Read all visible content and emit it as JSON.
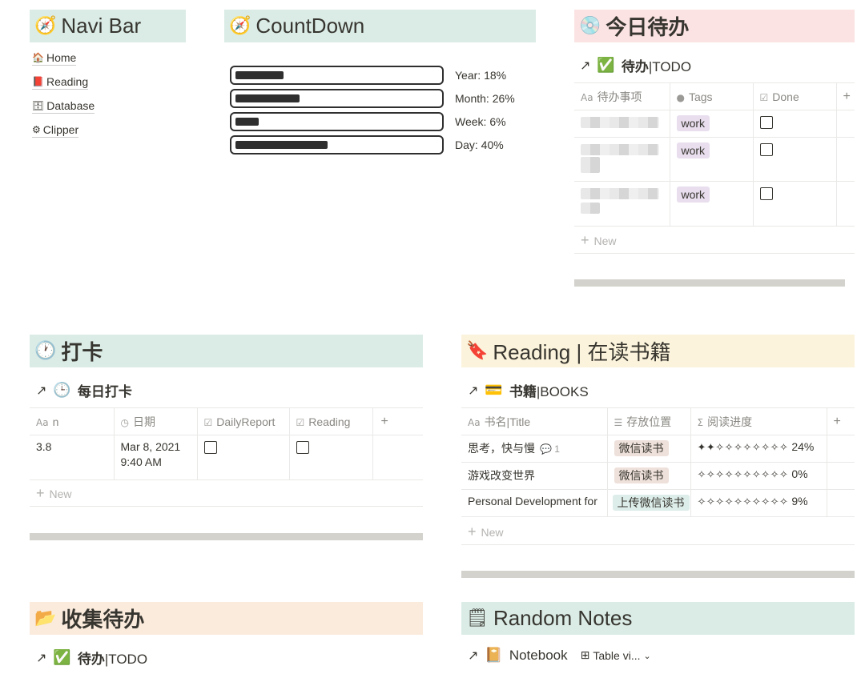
{
  "navi_bar": {
    "icon": "compass-icon",
    "title": "Navi Bar",
    "bg": "#dbece7",
    "links": [
      {
        "icon": "house-icon",
        "label": "Home"
      },
      {
        "icon": "book-icon",
        "label": "Reading"
      },
      {
        "icon": "cabinet-icon",
        "label": "Database"
      },
      {
        "icon": "gear-icon",
        "label": "Clipper"
      }
    ]
  },
  "countdown": {
    "icon": "compass-icon",
    "title": "CountDown",
    "bg": "#dbece7",
    "bars": [
      {
        "label": "Year: 18%",
        "percent": 18
      },
      {
        "label": "Month: 26%",
        "percent": 26
      },
      {
        "label": "Week: 6%",
        "percent": 6
      },
      {
        "label": "Day: 40%",
        "percent": 40
      }
    ]
  },
  "today_todo": {
    "icon": "disc-icon",
    "title": "今日待办",
    "bg": "#fbe3e3",
    "db_title_bold": "待办",
    "db_title_rest": "|TODO",
    "columns": [
      "待办事项",
      "Tags",
      "Done"
    ],
    "rows": [
      {
        "tag": "work",
        "done": false
      },
      {
        "tag": "work",
        "done": false
      },
      {
        "tag": "work",
        "done": false
      }
    ],
    "new_label": "New"
  },
  "checkin": {
    "icon": "clock-icon",
    "title": "打卡",
    "bg": "#dbece7",
    "db_title": "每日打卡",
    "columns": [
      "n",
      "日期",
      "DailyReport",
      "Reading"
    ],
    "rows": [
      {
        "n": "3.8",
        "date": "Mar 8, 2021",
        "time": "9:40 AM",
        "daily_report": false,
        "reading": false
      }
    ],
    "new_label": "New"
  },
  "reading": {
    "icon": "bookmark-icon",
    "title": "Reading | 在读书籍",
    "bg": "#fbf3db",
    "db_title_bold": "书籍",
    "db_title_rest": "|BOOKS",
    "columns": [
      "书名|Title",
      "存放位置",
      "阅读进度"
    ],
    "rows": [
      {
        "title": "思考，快与慢",
        "comments": "1",
        "location": "微信读书",
        "tag_color": "brown",
        "stars": "✦✦✧✧✧✧✧✧✧✧",
        "progress": "24%"
      },
      {
        "title": "游戏改变世界",
        "comments": "",
        "location": "微信读书",
        "tag_color": "brown",
        "stars": "✧✧✧✧✧✧✧✧✧✧",
        "progress": "0%"
      },
      {
        "title": "Personal Development for",
        "comments": "",
        "location": "上传微信读书",
        "tag_color": "teal",
        "stars": "✧✧✧✧✧✧✧✧✧✧",
        "progress": "9%"
      }
    ],
    "new_label": "New"
  },
  "collect_todo": {
    "icon": "folder-icon",
    "title": "收集待办",
    "bg": "#faebdd",
    "db_title_bold": "待办",
    "db_title_rest": "|TODO"
  },
  "random_notes": {
    "icon": "notepad-icon",
    "title": "Random Notes",
    "bg": "#dbece7",
    "db_title": "Notebook",
    "view_label": "Table vi..."
  }
}
